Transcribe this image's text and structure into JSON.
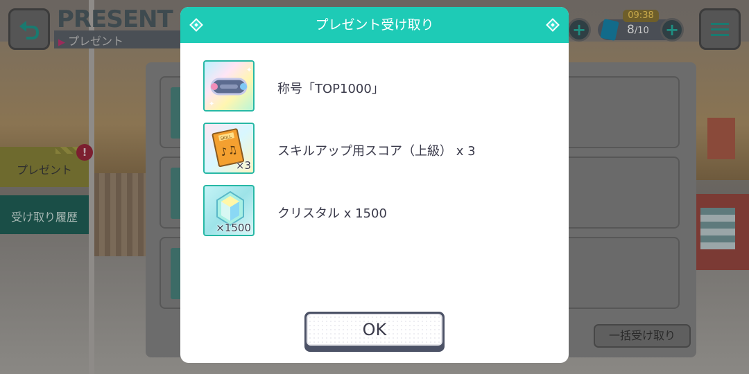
{
  "header": {
    "title": "PRESENT",
    "subtitle": "プレゼント"
  },
  "status": {
    "timer": "09:38",
    "stamina_current": "8",
    "stamina_max": "/10"
  },
  "left_tabs": {
    "present_label": "プレゼント",
    "badge": "!",
    "history_label": "受け取り履歴"
  },
  "list": {
    "bulk_receive_label": "一括受け取り"
  },
  "modal": {
    "title": "プレゼント受け取り",
    "items": [
      {
        "name": "称号「TOP1000」",
        "quantity": "",
        "icon": "title-badge-icon"
      },
      {
        "name": "スキルアップ用スコア（上級） x 3",
        "quantity": "×3",
        "icon": "skill-score-icon"
      },
      {
        "name": "クリスタル x 1500",
        "quantity": "×1500",
        "icon": "crystal-icon"
      }
    ],
    "ok_label": "OK"
  },
  "colors": {
    "accent": "#1ecbb6",
    "ok_border": "#4c5266",
    "item_text": "#3b3b4b"
  }
}
